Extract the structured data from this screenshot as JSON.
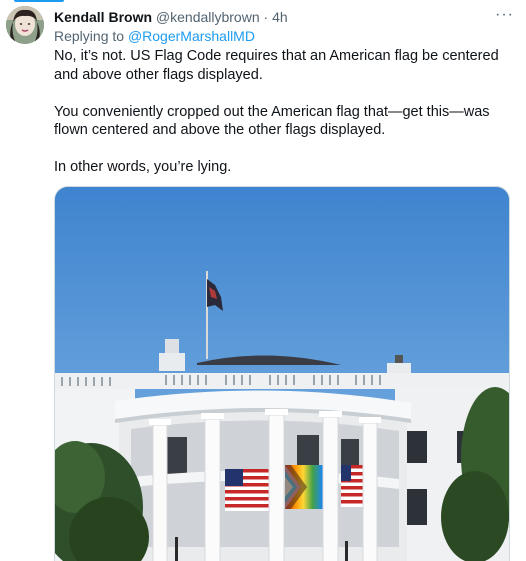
{
  "tweet": {
    "author_name": "Kendall Brown",
    "author_handle": "@kendallybrown",
    "separator": "·",
    "time_ago": "4h",
    "more_icon": "ellipsis-icon",
    "replying_prefix": "Replying to",
    "replying_to": "@RogerMarshallMD",
    "paragraphs": [
      "No, it’s not. US Flag Code requires that an American flag be centered and above other flags displayed.",
      "You conveniently cropped out the American flag that—get this—was flown centered and above the other flags displayed.",
      "In other words, you’re lying."
    ],
    "media_description_icon": "photo-white-house-flags"
  },
  "colors": {
    "link": "#1d9bf0",
    "text": "#0f1419",
    "muted": "#536471",
    "sky": "#4f8fd0"
  }
}
